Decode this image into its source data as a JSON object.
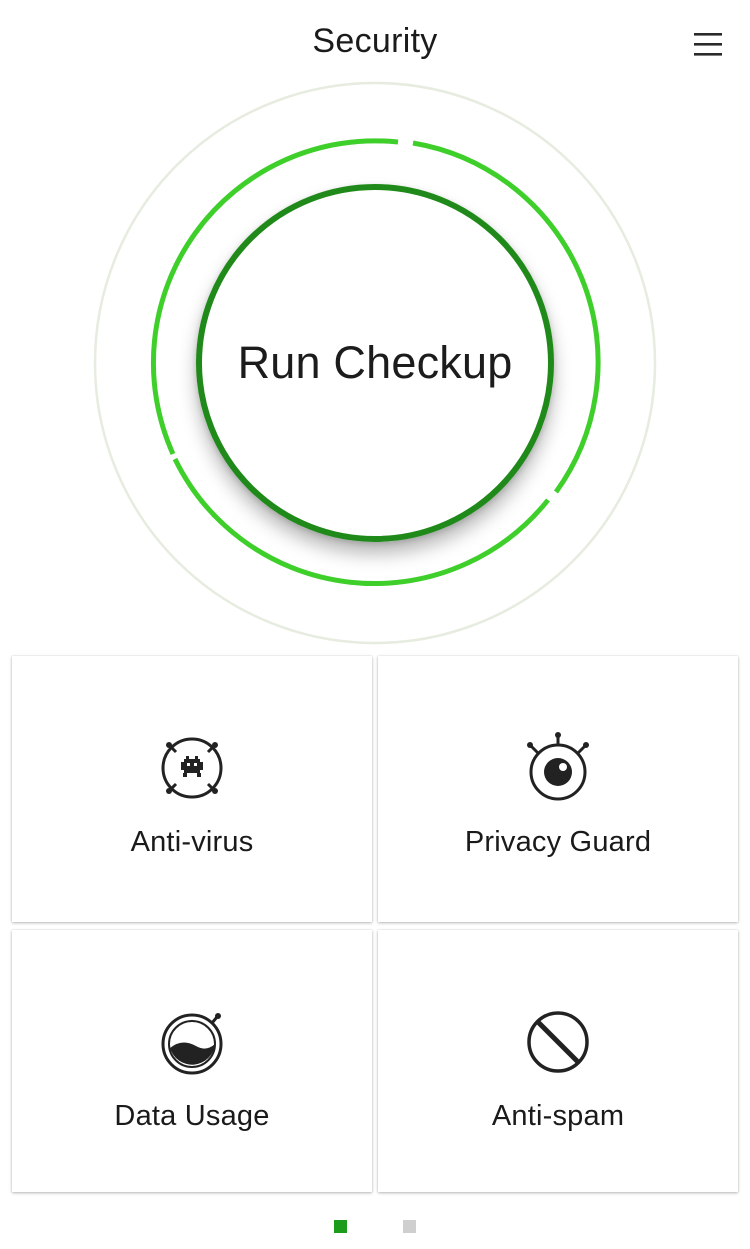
{
  "header": {
    "title": "Security",
    "menu_icon": "hamburger-menu-icon"
  },
  "hero": {
    "button_label": "Run Checkup",
    "colors": {
      "outer_ring": "#e6ecdf",
      "arc_bright": "#3fcf2b",
      "inner_ring": "#1f8a1a"
    }
  },
  "tiles": [
    {
      "label": "Anti-virus",
      "icon": "virus-bug-icon"
    },
    {
      "label": "Privacy Guard",
      "icon": "eye-camera-icon"
    },
    {
      "label": "Data Usage",
      "icon": "data-gauge-icon"
    },
    {
      "label": "Anti-spam",
      "icon": "prohibited-icon"
    }
  ],
  "pager": {
    "pages": 2,
    "active_index": 0,
    "active_color": "#1d9b1a",
    "inactive_color": "#cfcfcf"
  }
}
